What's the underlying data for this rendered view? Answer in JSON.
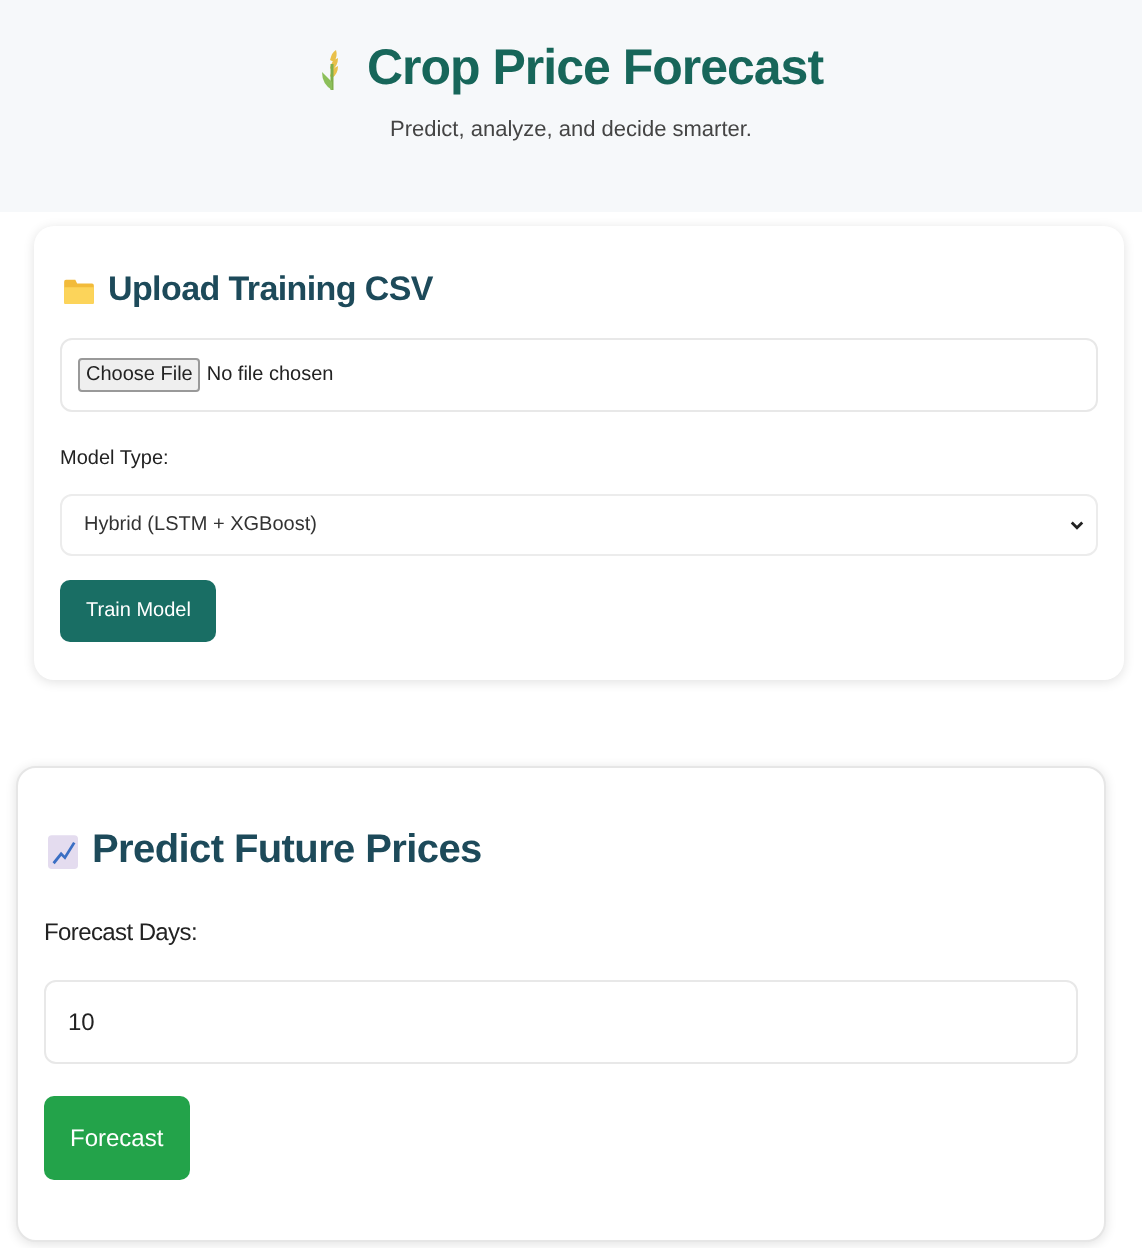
{
  "header": {
    "title": "Crop Price Forecast",
    "subtitle": "Predict, analyze, and decide smarter."
  },
  "upload_card": {
    "title": "Upload Training CSV",
    "file_button": "Choose File",
    "file_status": "No file chosen",
    "model_label": "Model Type:",
    "model_value": "Hybrid (LSTM + XGBoost)",
    "button": "Train Model"
  },
  "predict_card": {
    "title": "Predict Future Prices",
    "days_label": "Forecast Days:",
    "days_value": "10",
    "button": "Forecast"
  }
}
